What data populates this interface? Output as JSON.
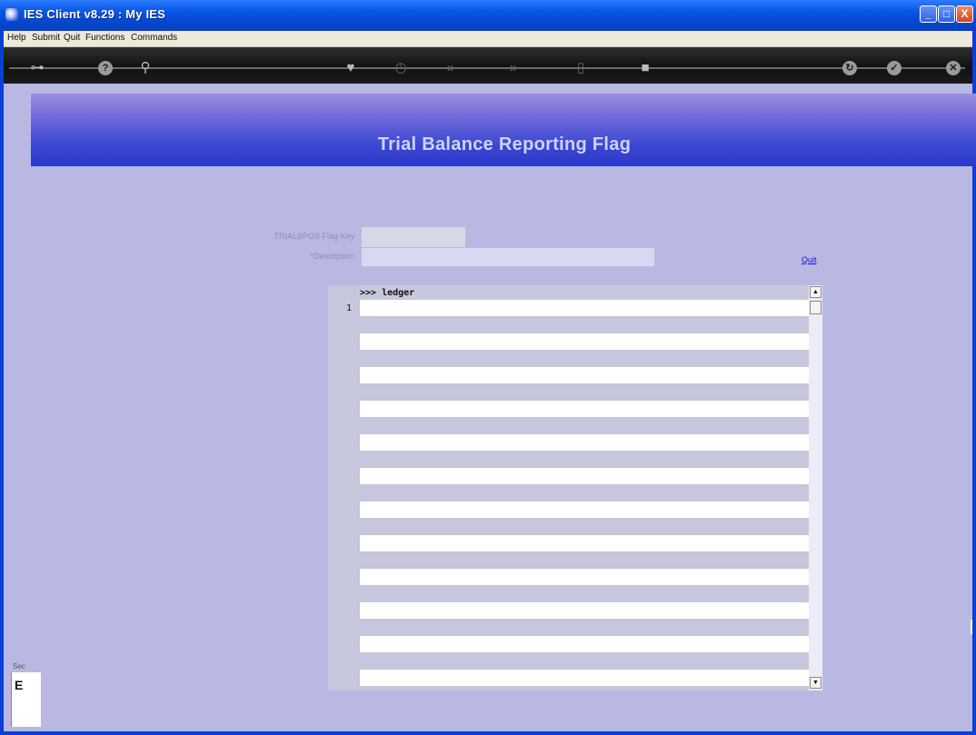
{
  "window": {
    "title": "IES Client v8.29 : My IES",
    "buttons": {
      "minimize": "_",
      "maximize": "□",
      "close": "X"
    }
  },
  "menubar": {
    "items": [
      "Help",
      "Submit",
      "Quit",
      "Functions",
      "Commands"
    ]
  },
  "toolbar": {
    "icons": [
      "key-icon",
      "help-icon",
      "search-icon",
      "heart-icon",
      "clock-icon",
      "back-icon",
      "forward-icon",
      "page-icon",
      "stop-icon",
      "refresh-icon",
      "ok-icon",
      "close-icon"
    ],
    "glyphs": {
      "key": "⊶",
      "help": "?",
      "search": "⚲",
      "heart": "♥",
      "clock": "◷",
      "back": "«",
      "forward": "»",
      "page": "▯",
      "stop": "■",
      "refresh": "↻",
      "ok": "✓",
      "close": "✕"
    }
  },
  "banner": {
    "title": "Trial Balance Reporting Flag"
  },
  "form": {
    "flag_key_label": "TRIALBPOS Flag Key",
    "flag_key_value": "",
    "description_label": "*Description",
    "description_value": "",
    "quit_link": "Quit"
  },
  "grid": {
    "header": ">>> ledger",
    "first_row_number": "1",
    "scroll_up": "▲",
    "scroll_down": "▼"
  },
  "side": {
    "text": "Sec",
    "letter": "E"
  },
  "colors": {
    "background": "#b9b8e2",
    "banner_title": "#ccd4ff",
    "link": "#1010d0"
  }
}
